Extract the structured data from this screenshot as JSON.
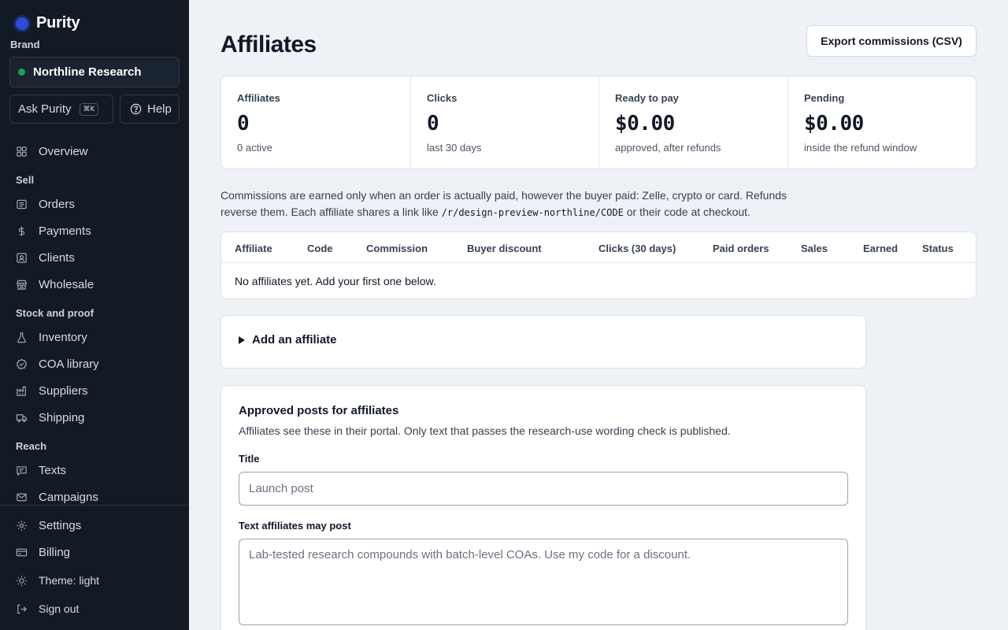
{
  "app": {
    "name": "Purity"
  },
  "sidebar": {
    "brand_label": "Brand",
    "brand_name": "Northline Research",
    "ask_label": "Ask Purity",
    "ask_shortcut": "⌘K",
    "help_label": "Help",
    "overview": "Overview",
    "sections": {
      "sell": "Sell",
      "stock": "Stock and proof",
      "reach": "Reach"
    },
    "items": {
      "orders": "Orders",
      "payments": "Payments",
      "clients": "Clients",
      "wholesale": "Wholesale",
      "inventory": "Inventory",
      "coa": "COA library",
      "suppliers": "Suppliers",
      "shipping": "Shipping",
      "texts": "Texts",
      "campaigns": "Campaigns"
    },
    "bottom": {
      "settings": "Settings",
      "billing": "Billing",
      "theme": "Theme: light",
      "signout": "Sign out"
    }
  },
  "page": {
    "title": "Affiliates",
    "export_label": "Export commissions (CSV)"
  },
  "stats": [
    {
      "label": "Affiliates",
      "value": "0",
      "sub": "0 active"
    },
    {
      "label": "Clicks",
      "value": "0",
      "sub": "last 30 days"
    },
    {
      "label": "Ready to pay",
      "value": "$0.00",
      "sub": "approved, after refunds"
    },
    {
      "label": "Pending",
      "value": "$0.00",
      "sub": "inside the refund window"
    }
  ],
  "note": {
    "before": "Commissions are earned only when an order is actually paid, however the buyer paid: Zelle, crypto or card. Refunds reverse them. Each affiliate shares a link like ",
    "code": "/r/design-preview-northline/CODE",
    "after": " or their code at checkout."
  },
  "table": {
    "columns": [
      "Affiliate",
      "Code",
      "Commission",
      "Buyer discount",
      "Clicks (30 days)",
      "Paid orders",
      "Sales",
      "Earned",
      "Status"
    ],
    "empty_message": "No affiliates yet. Add your first one below."
  },
  "add_affiliate": {
    "label": "Add an affiliate"
  },
  "posts": {
    "title": "Approved posts for affiliates",
    "description": "Affiliates see these in their portal. Only text that passes the research-use wording check is published.",
    "title_label": "Title",
    "title_placeholder": "Launch post",
    "text_label": "Text affiliates may post",
    "text_placeholder": "Lab-tested research compounds with batch-level COAs. Use my code for a discount."
  },
  "colors": {
    "sidebar_bg": "#121a24",
    "accent": "#2f4bd8",
    "status_active": "#1f9d55",
    "page_bg": "#eef1f5"
  }
}
